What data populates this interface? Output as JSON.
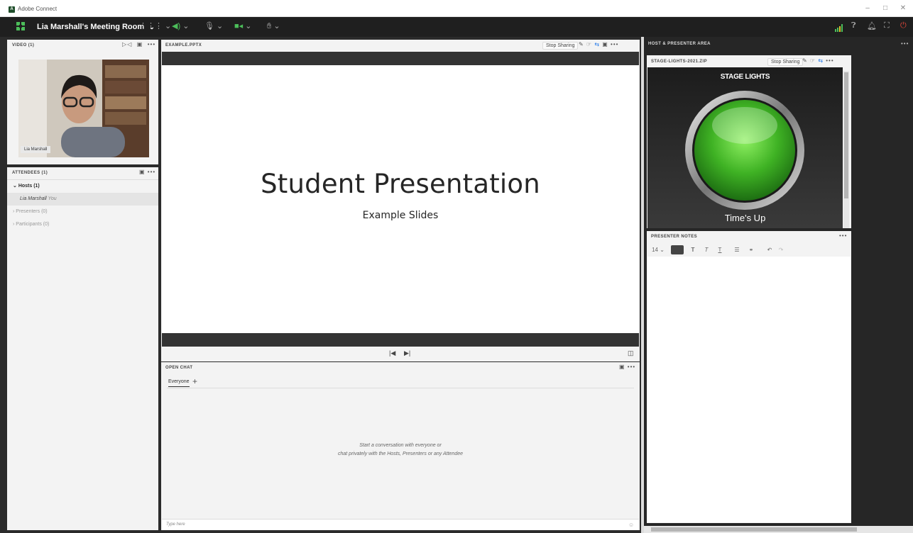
{
  "window": {
    "title": "Adobe Connect",
    "controls": [
      "–",
      "□",
      "✕"
    ]
  },
  "toolbar": {
    "room_name": "Lia Marshall's Meeting Room",
    "room_chevron": "⌄"
  },
  "video_pod": {
    "header": "VIDEO (1)",
    "participant_label": "Lia Marshall"
  },
  "attendees_pod": {
    "header": "ATTENDEES (1)",
    "hosts": "Hosts (1)",
    "host_user": "Lia Marshall",
    "host_you": "You",
    "presenters": "Presenters (0)",
    "participants": "Participants (0)"
  },
  "share_pod": {
    "header": "EXAMPLE.PPTX",
    "stop_sharing": "Stop Sharing",
    "slide_title": "Student Presentation",
    "slide_subtitle": "Example Slides"
  },
  "chat_pod": {
    "header": "OPEN CHAT",
    "tab": "Everyone",
    "add_tab": "+",
    "empty_line1": "Start a conversation with everyone or",
    "empty_line2": "chat privately with the Hosts, Presenters or any Attendee",
    "input_placeholder": "Type here"
  },
  "host_area": {
    "header": "HOST & PRESENTER AREA",
    "stage_pod": {
      "header": "STAGE-LIGHTS-2021.ZIP",
      "stop_sharing": "Stop Sharing",
      "banner": "STAGE LIGHTS",
      "caption": "Time's Up"
    },
    "notes_pod": {
      "header": "PRESENTER NOTES",
      "font_size": "14"
    }
  },
  "colors": {
    "toolbar_bg": "#1f1f1f",
    "accent_green": "#4cbe5a",
    "light_green": "#5fd43c",
    "pod_bg": "#f3f3f3"
  }
}
